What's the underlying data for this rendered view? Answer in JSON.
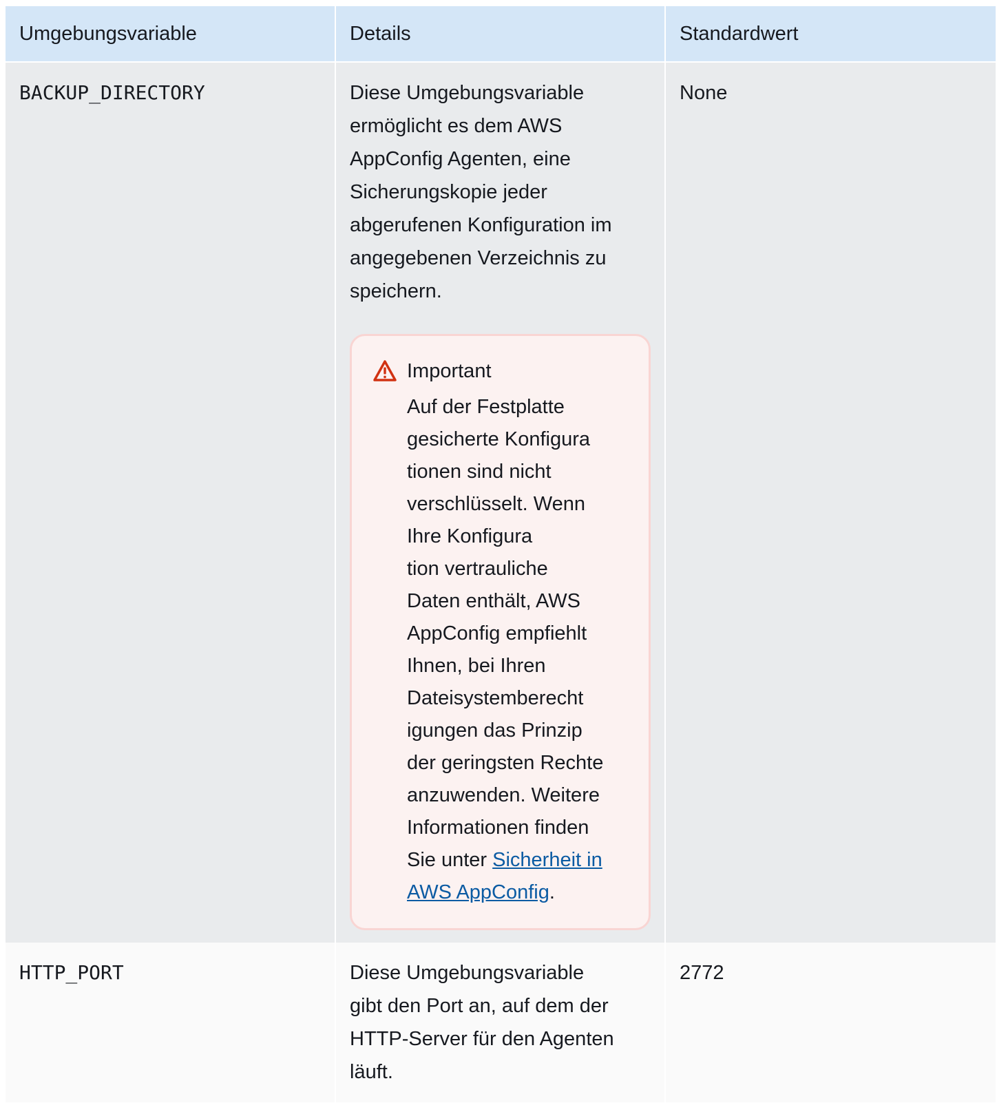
{
  "table": {
    "headers": [
      "Umgebungsvariable",
      "Details",
      "Standardwert"
    ],
    "rows": [
      {
        "variable": "BACKUP_DIRECTORY",
        "details_lines": [
          "Diese Umgebungsvariable",
          "ermöglicht es dem AWS",
          "AppConfig Agenten, eine",
          "Sicherungskopie jeder",
          "abgerufenen Konfiguration im",
          "angegebenen Verzeichnis zu",
          "speichern."
        ],
        "callout": {
          "title": "Important",
          "body_lines": [
            "Auf der Festplatte",
            "gesicherte Konfigura",
            "tionen sind nicht",
            "verschlüsselt. Wenn",
            "Ihre Konfigura",
            "tion vertrauliche",
            "Daten enthält, AWS",
            "AppConfig empfiehlt",
            "Ihnen, bei Ihren",
            "Dateisystemberecht",
            "igungen das Prinzip",
            "der geringsten Rechte",
            "anzuwenden. Weitere",
            "Informationen finden"
          ],
          "last_prefix": "Sie unter ",
          "link_part1": "Sicherheit in",
          "link_part2": "AWS AppConfig",
          "last_suffix": "."
        },
        "default": "None"
      },
      {
        "variable": "HTTP_PORT",
        "details_lines": [
          "Diese Umgebungsvariable",
          "gibt den Port an, auf dem der",
          "HTTP-Server für den Agenten",
          "läuft."
        ],
        "default": "2772"
      }
    ]
  },
  "colors": {
    "header_bg": "#d4e6f7",
    "row_odd_bg": "#e9ebed",
    "row_even_bg": "#fafafa",
    "callout_bg": "#fcf2f1",
    "callout_border": "#f9d5d3",
    "warning_icon": "#d13212",
    "link": "#0b5ba3"
  }
}
